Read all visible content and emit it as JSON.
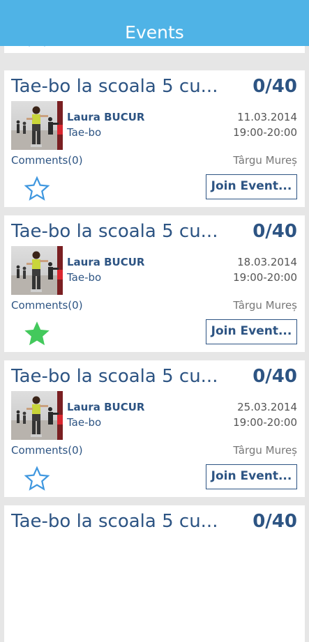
{
  "header": {
    "title": "Events"
  },
  "colors": {
    "header_bg": "#4fb3e6",
    "title_text": "#2d5483",
    "star_outline": "#3f97df",
    "star_filled": "#43c95c"
  },
  "events": [
    {
      "title": "Tae-bo la scoala 5 cu...",
      "count": "0/40",
      "organizer": "Laura BUCUR",
      "category": "Tae-bo",
      "date": "11.03.2014",
      "time": "19:00-20:00",
      "comments": "Comments(0)",
      "city": "Târgu Mureș",
      "favorite": false,
      "join_label": "Join Event..."
    },
    {
      "title": "Tae-bo la scoala 5 cu...",
      "count": "0/40",
      "organizer": "Laura BUCUR",
      "category": "Tae-bo",
      "date": "18.03.2014",
      "time": "19:00-20:00",
      "comments": "Comments(0)",
      "city": "Târgu Mureș",
      "favorite": true,
      "join_label": "Join Event..."
    },
    {
      "title": "Tae-bo la scoala 5 cu...",
      "count": "0/40",
      "organizer": "Laura BUCUR",
      "category": "Tae-bo",
      "date": "25.03.2014",
      "time": "19:00-20:00",
      "comments": "Comments(0)",
      "city": "Târgu Mureș",
      "favorite": false,
      "join_label": "Join Event..."
    }
  ]
}
